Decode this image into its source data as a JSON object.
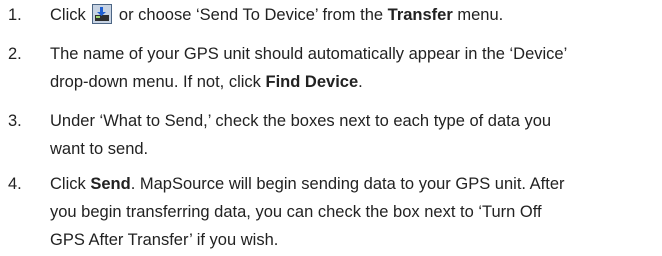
{
  "steps": [
    {
      "number": "1.",
      "parts": {
        "a": "Click ",
        "icon": "send-to-device-icon",
        "b": " or choose ‘Send To Device’ from the ",
        "c": "Transfer",
        "d": " menu."
      }
    },
    {
      "number": "2.",
      "line1": "The name of your GPS unit should automatically appear in the ‘Device’",
      "line2_a": "drop-down menu. If not, click ",
      "line2_b": "Find Device",
      "line2_c": "."
    },
    {
      "number": "3.",
      "line1": "Under ‘What to Send,’ check the boxes next to each type of data you",
      "line2": "want to send."
    },
    {
      "number": "4.",
      "line1_a": "Click ",
      "line1_b": "Send",
      "line1_c": ". MapSource will begin sending data to your GPS unit. After",
      "line2": "you begin transferring data, you can check the box next to ‘Turn Off",
      "line3": "GPS After Transfer’ if you wish."
    }
  ]
}
